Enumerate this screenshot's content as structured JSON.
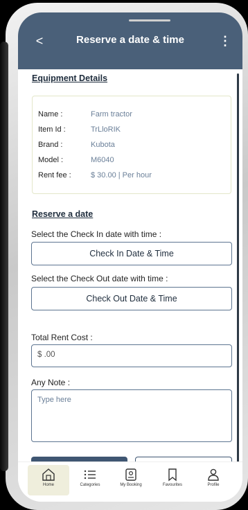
{
  "app_bar": {
    "title": "Reserve a date & time",
    "back_icon": "chevron-left-icon",
    "back_glyph": "<",
    "more_icon": "more-vertical-icon",
    "more_glyph": "⋮"
  },
  "equipment": {
    "heading": "Equipment Details",
    "rows": [
      {
        "label": "Name :",
        "value": "Farm tractor"
      },
      {
        "label": "Item Id :",
        "value": "TrLloRIK"
      },
      {
        "label": "Brand :",
        "value": "Kubota"
      },
      {
        "label": "Model :",
        "value": "M6040"
      },
      {
        "label": "Rent fee :",
        "value": "$ 30.00 | Per hour"
      }
    ]
  },
  "reserve": {
    "heading": "Reserve a date ",
    "checkin_label": "Select the Check In date with time :",
    "checkin_button": "Check In Date & Time",
    "checkout_label": "Select the Check Out date with time  :",
    "checkout_button": "Check Out Date & Time"
  },
  "cost": {
    "label": "Total Rent Cost :",
    "value": "$ .00"
  },
  "note": {
    "label": "Any Note :",
    "placeholder": "Type here"
  },
  "bottom_nav": {
    "items": [
      {
        "label": "Home",
        "icon": "home-icon",
        "active": true
      },
      {
        "label": "Categories",
        "icon": "list-icon",
        "active": false
      },
      {
        "label": "My Booking",
        "icon": "booking-icon",
        "active": false
      },
      {
        "label": "Favourites",
        "icon": "bookmark-icon",
        "active": false
      },
      {
        "label": "Profile",
        "icon": "user-icon",
        "active": false
      }
    ]
  },
  "colors": {
    "app_bar": "#4a6079",
    "accent": "#5c7490",
    "value_text": "#6a7f98",
    "active_nav_bg": "#efeedc"
  }
}
